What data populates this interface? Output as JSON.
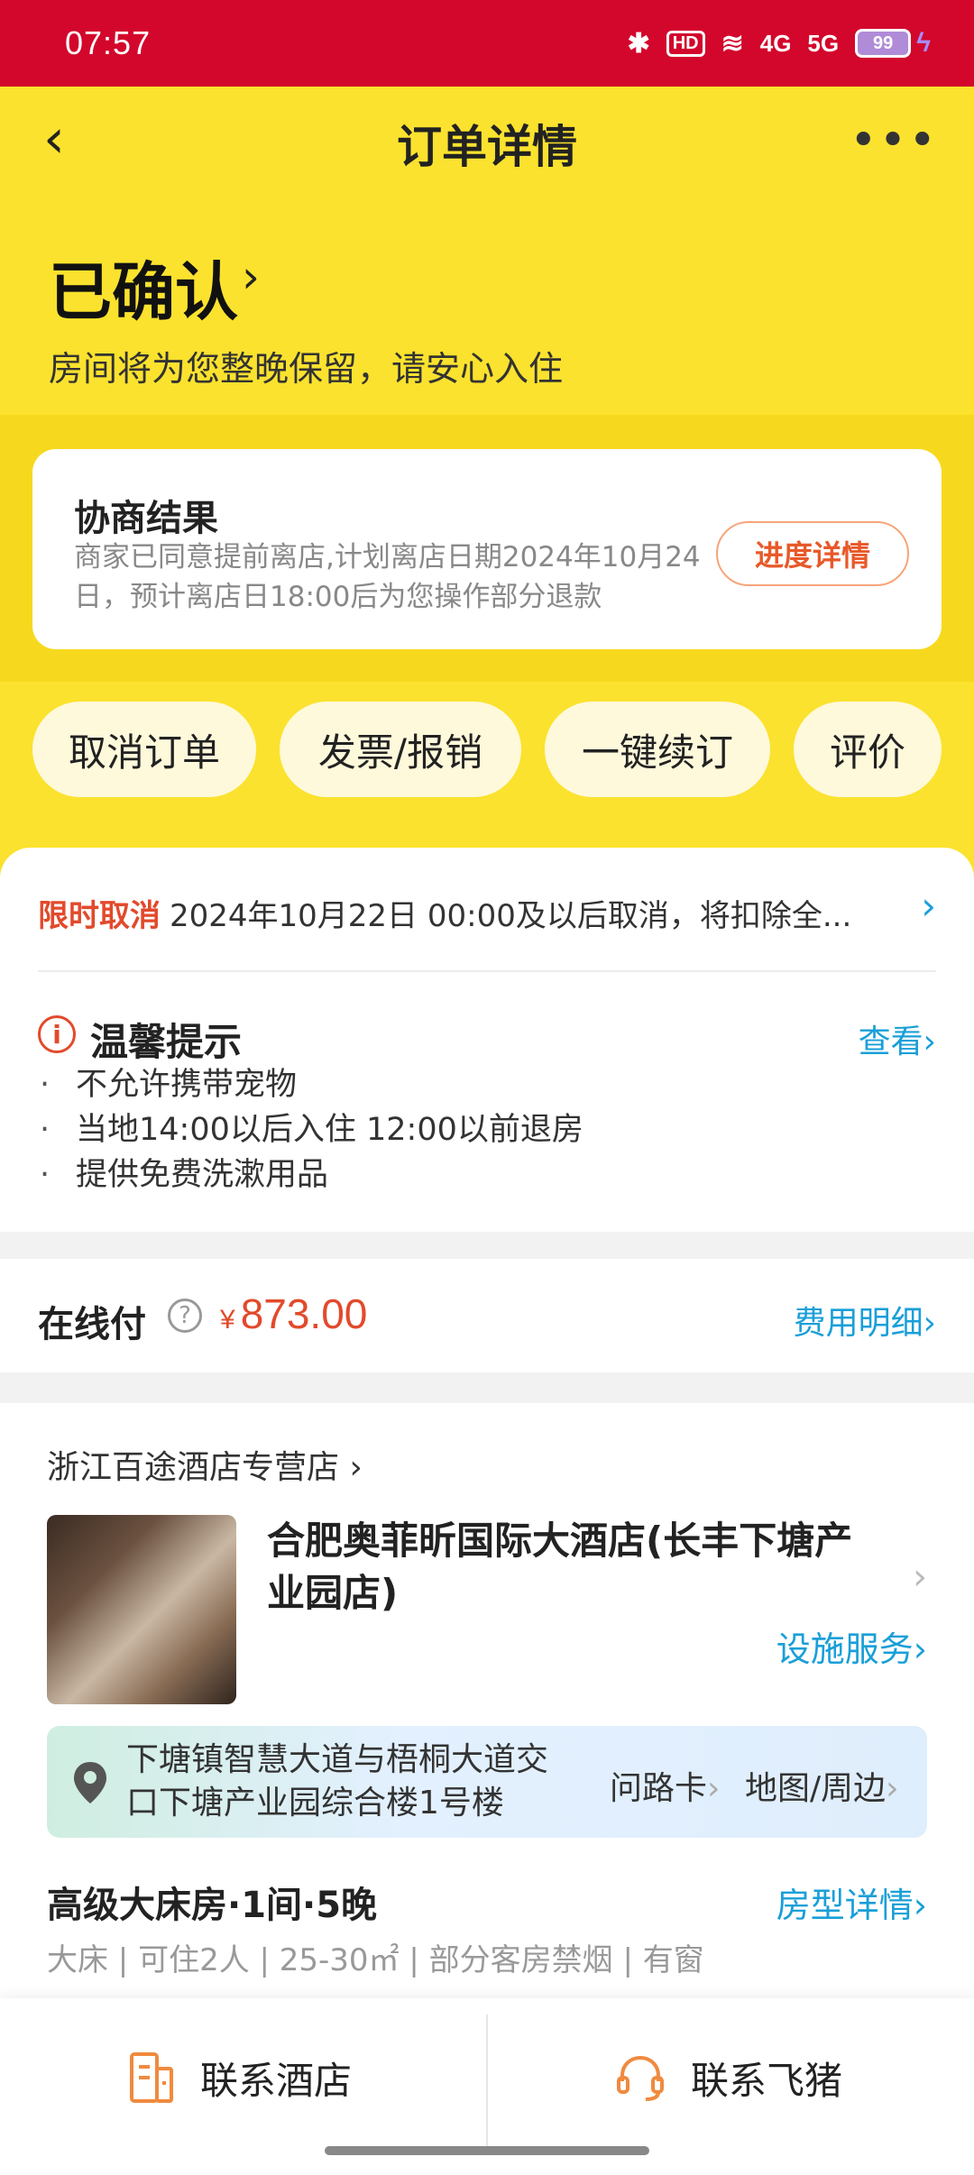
{
  "status_bar": {
    "time": "07:57",
    "bluetooth": "✱",
    "hd": "HD",
    "wifi": "≋",
    "net1": "4G",
    "net2": "5G",
    "battery": "99"
  },
  "nav": {
    "back_icon": "‹",
    "title": "订单详情",
    "more_icon": "•••"
  },
  "order_status": {
    "title": "已确认",
    "chevron": "›",
    "subtitle": "房间将为您整晚保留，请安心入住"
  },
  "negotiation": {
    "title": "协商结果",
    "text": "商家已同意提前离店,计划离店日期2024年10月24日，预计离店日18:00后为您操作部分退款",
    "button": "进度详情"
  },
  "actions": [
    {
      "label": "取消订单"
    },
    {
      "label": "发票/报销"
    },
    {
      "label": "一键续订"
    },
    {
      "label": "评价"
    }
  ],
  "cancel_policy": {
    "label": "限时取消",
    "text": "2024年10月22日 00:00及以后取消，将扣除全...",
    "chevron": "›"
  },
  "tips": {
    "icon": "i",
    "title": "温馨提示",
    "link": "查看›",
    "bullet": "·",
    "items": [
      "不允许携带宠物",
      "当地14:00以后入住 12:00以前退房",
      "提供免费洗漱用品"
    ]
  },
  "payment": {
    "label": "在线付",
    "help_icon": "?",
    "currency": "¥",
    "amount": "873.00",
    "link": "费用明细›"
  },
  "hotel": {
    "shop_name": "浙江百途酒店专营店 ›",
    "name": "合肥奥菲昕国际大酒店(长丰下塘产业园店)",
    "chevron": "›",
    "facility_link": "设施服务›",
    "address": "下塘镇智慧大道与梧桐大道交口下塘产业园综合楼1号楼",
    "route_card": "问路卡",
    "map_link": "地图/周边",
    "room_title": "高级大床房·1间·5晚",
    "room_link": "房型详情›",
    "room_meta": "大床 | 可住2人 | 25-30㎡ | 部分客房禁烟 | 有窗"
  },
  "bottom": {
    "contact_hotel": "联系酒店",
    "contact_fliggy": "联系飞猪"
  },
  "colors": {
    "status_bar": "#d3062c",
    "header_yellow": "#fbe22e",
    "accent_red": "#e24a2b",
    "link_blue": "#1a9fd8"
  }
}
